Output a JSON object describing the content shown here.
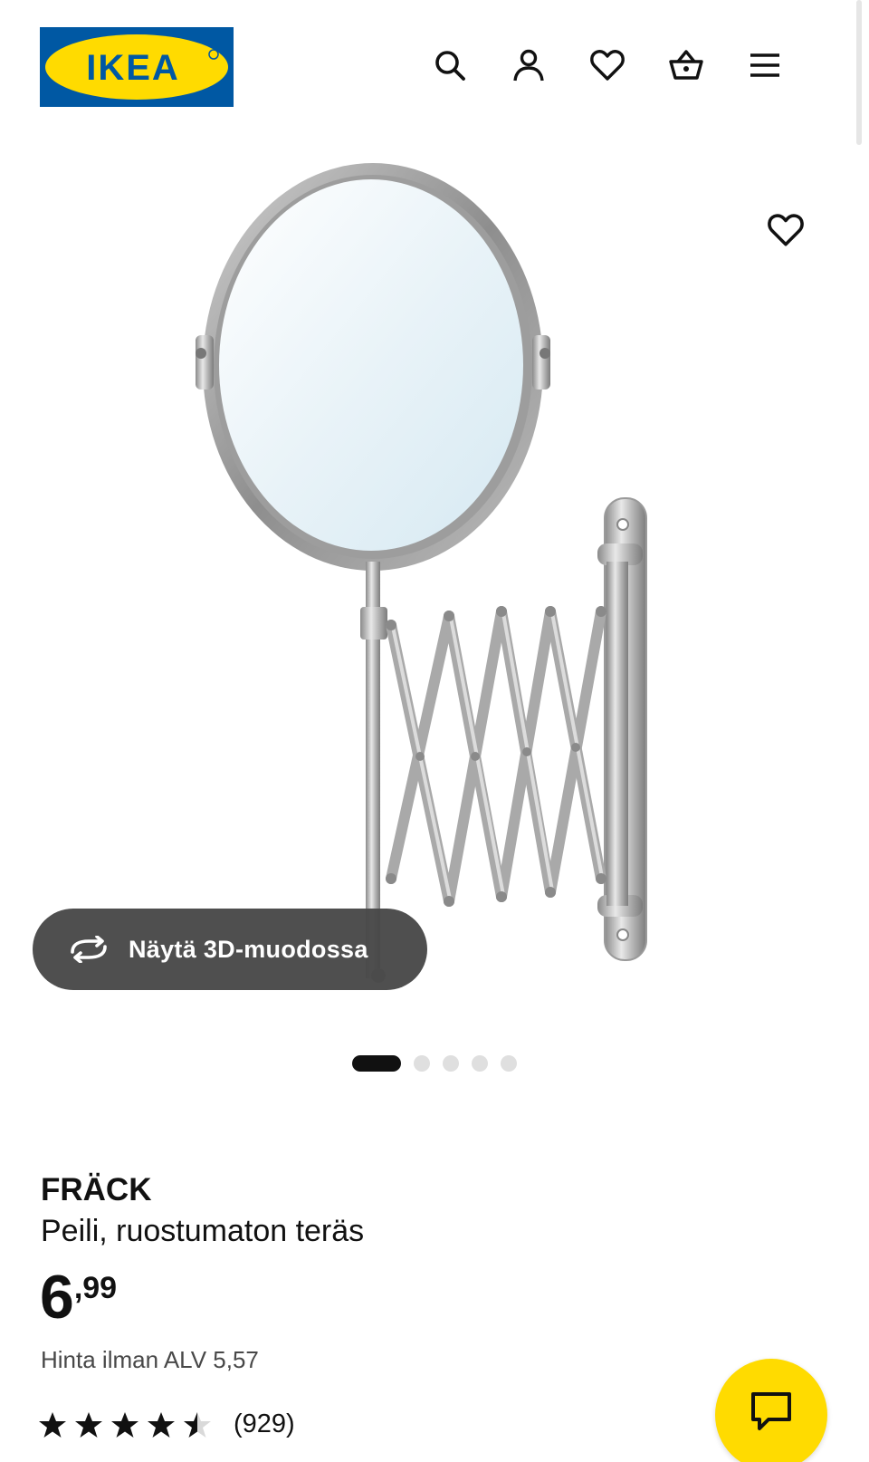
{
  "brand": {
    "logo_text": "IKEA",
    "colors": {
      "blue": "#0058a3",
      "yellow": "#ffdb00"
    }
  },
  "header": {
    "icons": [
      "search-icon",
      "account-icon",
      "heart-icon",
      "basket-icon",
      "menu-icon"
    ]
  },
  "gallery": {
    "view_3d_label": "Näytä 3D-muodossa",
    "image_count": 5,
    "active_index": 0
  },
  "product": {
    "name": "FRÄCK",
    "description": "Peili, ruostumaton teräs",
    "price_integer": "6",
    "price_decimal": ",99",
    "price_excl_vat": "Hinta ilman ALV 5,57",
    "rating": 4.5,
    "rating_max": 5,
    "review_count": "(929)"
  },
  "chat": {
    "icon": "chat-icon",
    "color": "#ffdb00"
  }
}
